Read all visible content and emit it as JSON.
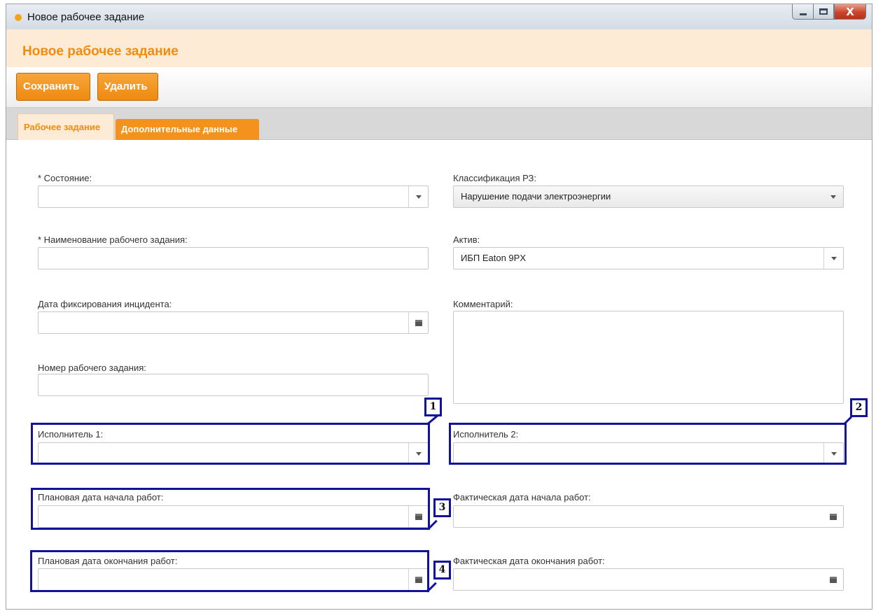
{
  "window": {
    "title": "Новое рабочее задание",
    "close_glyph": "X"
  },
  "header": {
    "title": "Новое рабочее задание"
  },
  "toolbar": {
    "save_label": "Сохранить",
    "delete_label": "Удалить"
  },
  "tabs": [
    {
      "label": "Рабочее задание",
      "active": true
    },
    {
      "label": "Дополнительные данные",
      "active": false
    }
  ],
  "form": {
    "state": {
      "label": "* Состояние:",
      "value": ""
    },
    "classification": {
      "label": "Классификация РЗ:",
      "value": "Нарушение подачи электроэнергии"
    },
    "task_name": {
      "label": "* Наименование рабочего задания:",
      "value": ""
    },
    "asset": {
      "label": "Актив:",
      "value": "ИБП Eaton 9PX"
    },
    "incident_date": {
      "label": "Дата фиксирования инцидента:",
      "value": ""
    },
    "comment": {
      "label": "Комментарий:",
      "value": ""
    },
    "task_number": {
      "label": "Номер рабочего задания:",
      "value": ""
    },
    "executor1": {
      "label": "Исполнитель 1:",
      "value": ""
    },
    "executor2": {
      "label": "Исполнитель 2:",
      "value": ""
    },
    "planned_start": {
      "label": "Плановая дата начала работ:",
      "value": ""
    },
    "actual_start": {
      "label": "Фактическая дата начала работ:",
      "value": ""
    },
    "planned_end": {
      "label": "Плановая дата окончания работ:",
      "value": ""
    },
    "actual_end": {
      "label": "Фактическая дата окончания работ:",
      "value": ""
    }
  },
  "callouts": [
    "1",
    "2",
    "3",
    "4"
  ],
  "colors": {
    "accent": "#f28c0f",
    "header_bg": "#fdebd6",
    "highlight": "#12129b"
  }
}
